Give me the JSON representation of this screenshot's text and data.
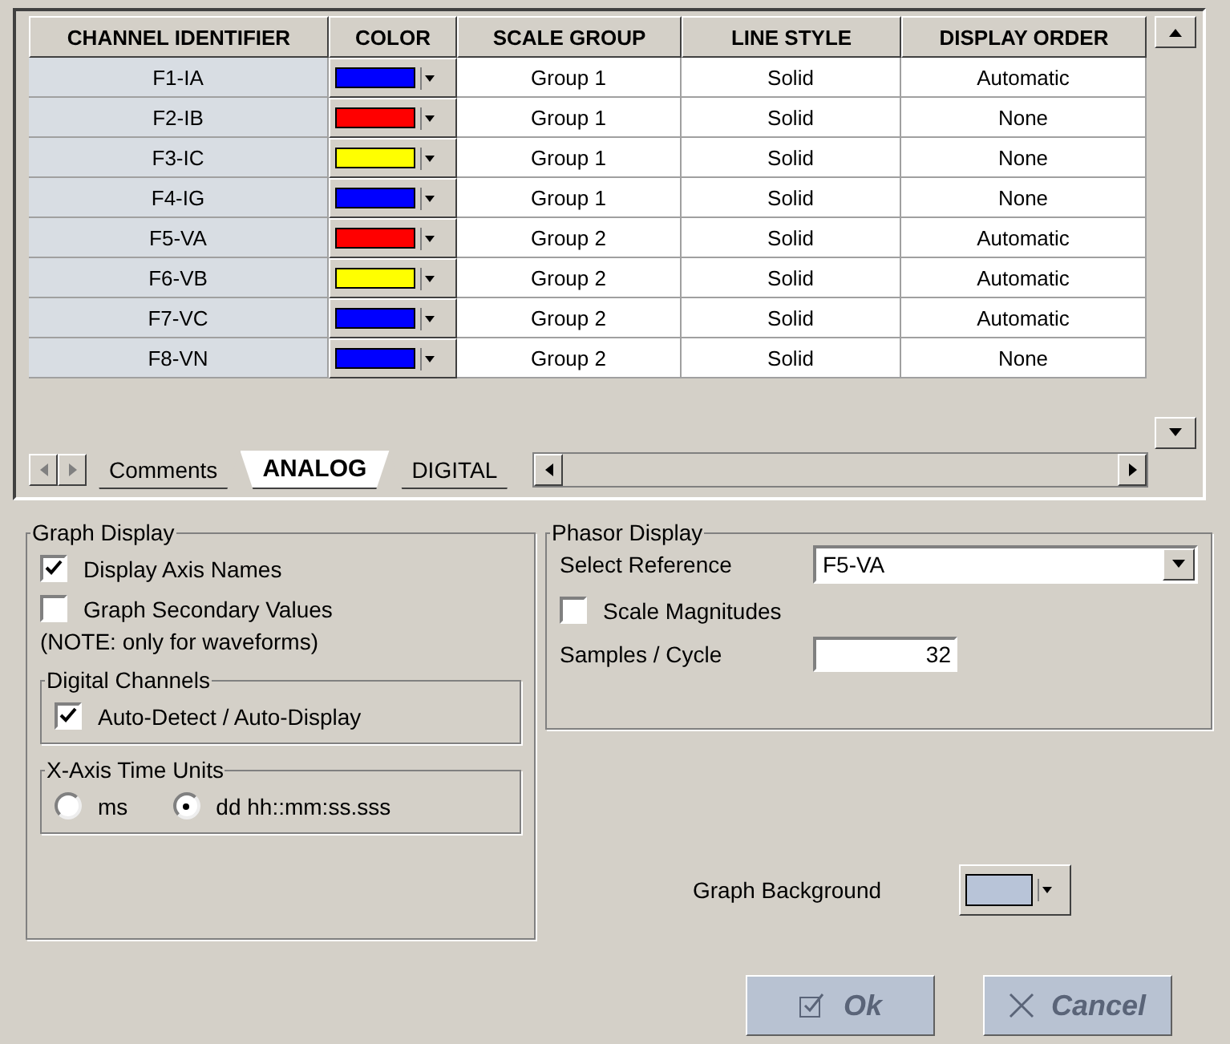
{
  "table": {
    "columns": [
      "CHANNEL IDENTIFIER",
      "COLOR",
      "SCALE GROUP",
      "LINE STYLE",
      "DISPLAY ORDER"
    ],
    "rows": [
      {
        "channel": "F1-IA",
        "color": "#0000ff",
        "scale_group": "Group 1",
        "line_style": "Solid",
        "display_order": "Automatic"
      },
      {
        "channel": "F2-IB",
        "color": "#ff0000",
        "scale_group": "Group 1",
        "line_style": "Solid",
        "display_order": "None"
      },
      {
        "channel": "F3-IC",
        "color": "#ffff00",
        "scale_group": "Group 1",
        "line_style": "Solid",
        "display_order": "None"
      },
      {
        "channel": "F4-IG",
        "color": "#0000ff",
        "scale_group": "Group 1",
        "line_style": "Solid",
        "display_order": "None"
      },
      {
        "channel": "F5-VA",
        "color": "#ff0000",
        "scale_group": "Group 2",
        "line_style": "Solid",
        "display_order": "Automatic"
      },
      {
        "channel": "F6-VB",
        "color": "#ffff00",
        "scale_group": "Group 2",
        "line_style": "Solid",
        "display_order": "Automatic"
      },
      {
        "channel": "F7-VC",
        "color": "#0000ff",
        "scale_group": "Group 2",
        "line_style": "Solid",
        "display_order": "Automatic"
      },
      {
        "channel": "F8-VN",
        "color": "#0000ff",
        "scale_group": "Group 2",
        "line_style": "Solid",
        "display_order": "None"
      }
    ]
  },
  "sheet_tabs": [
    {
      "label": "Comments",
      "selected": false
    },
    {
      "label": "ANALOG",
      "selected": true
    },
    {
      "label": "DIGITAL",
      "selected": false
    }
  ],
  "graph_display": {
    "title": "Graph Display",
    "checkboxes": [
      {
        "label": "Display Axis Names",
        "checked": true
      },
      {
        "label": "Graph Secondary Values",
        "checked": false
      }
    ],
    "note": "(NOTE:  only for waveforms)",
    "digital_channels": {
      "title": "Digital Channels",
      "checkbox": {
        "label": "Auto-Detect / Auto-Display",
        "checked": true
      }
    },
    "time_units": {
      "title": "X-Axis Time Units",
      "options": [
        {
          "label": "ms",
          "selected": false
        },
        {
          "label": "dd hh::mm:ss.sss",
          "selected": true
        }
      ]
    }
  },
  "phasor_display": {
    "title": "Phasor Display",
    "reference_label": "Select Reference",
    "reference_value": "F5-VA",
    "scale_magnitudes": {
      "label": "Scale Magnitudes",
      "checked": false
    },
    "samples_label": "Samples / Cycle",
    "samples_value": "32"
  },
  "graph_background": {
    "label": "Graph Background",
    "color": "#b8c4d8"
  },
  "buttons": [
    {
      "kind": "ok",
      "label": "Ok",
      "disabled": true
    },
    {
      "kind": "cancel",
      "label": "Cancel",
      "disabled": true
    }
  ]
}
